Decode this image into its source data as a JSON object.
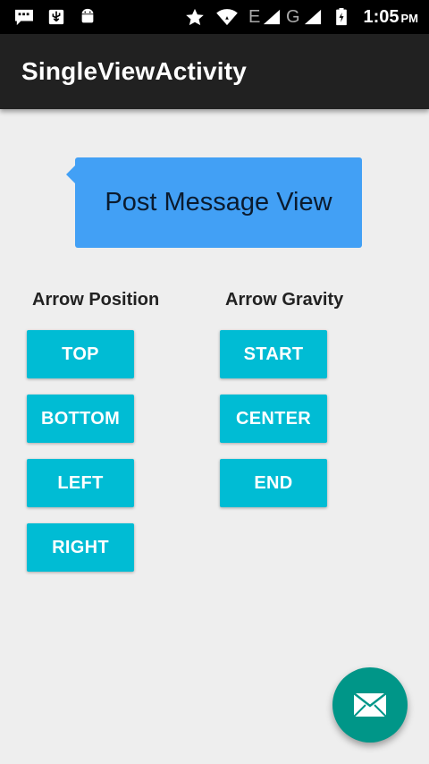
{
  "status_bar": {
    "time": "1:05",
    "ampm": "PM",
    "network_e_label": "E",
    "network_g_label": "G",
    "icons": [
      "message-icon",
      "usb-icon",
      "android-icon",
      "star-icon",
      "wifi-icon",
      "signal-icon",
      "signal-icon",
      "battery-icon"
    ]
  },
  "app_bar": {
    "title": "SingleViewActivity"
  },
  "bubble": {
    "text": "Post Message View",
    "color": "#42a0f5"
  },
  "arrow_position": {
    "label": "Arrow Position",
    "buttons": [
      "TOP",
      "BOTTOM",
      "LEFT",
      "RIGHT"
    ]
  },
  "arrow_gravity": {
    "label": "Arrow Gravity",
    "buttons": [
      "START",
      "CENTER",
      "END"
    ]
  },
  "colors": {
    "app_bar": "#212121",
    "button": "#00bcd4",
    "fab": "#009688",
    "background": "#eeeeee"
  },
  "fab": {
    "icon": "mail-icon"
  }
}
